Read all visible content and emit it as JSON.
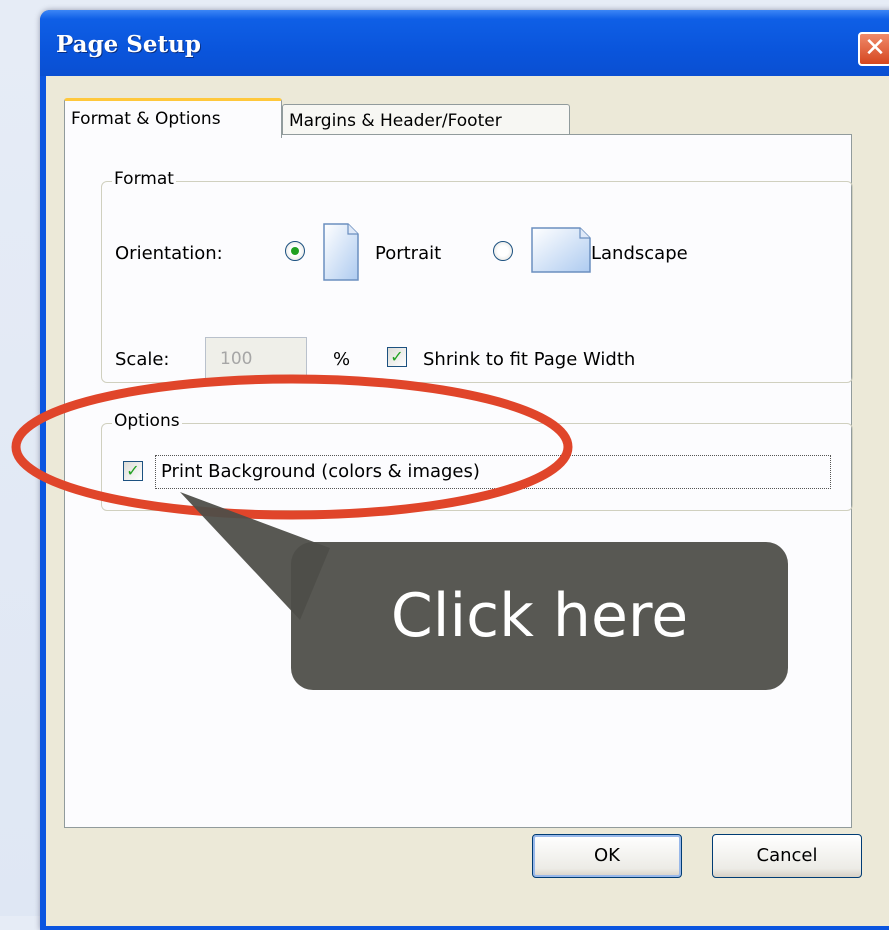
{
  "dialog": {
    "title": "Page Setup",
    "close_symbol": "✕"
  },
  "tabs": [
    {
      "label": "Format & Options",
      "active": true
    },
    {
      "label": "Margins & Header/Footer",
      "active": false
    }
  ],
  "format_group": {
    "label": "Format",
    "orientation_label": "Orientation:",
    "portrait_label": "Portrait",
    "landscape_label": "Landscape",
    "selected_orientation": "Portrait",
    "scale_label": "Scale:",
    "scale_value": "100",
    "percent_symbol": "%",
    "shrink_label": "Shrink to fit Page Width",
    "shrink_checked": true
  },
  "options_group": {
    "label": "Options",
    "print_background_label": "Print Background (colors & images)",
    "print_background_checked": true
  },
  "buttons": {
    "ok": "OK",
    "cancel": "Cancel"
  },
  "annotation": {
    "callout_text": "Click here",
    "highlight_color": "#e0452a",
    "callout_color": "#4e4e48"
  },
  "icons": {
    "portrait": "page-portrait-icon",
    "landscape": "page-landscape-icon",
    "check": "checkmark-icon"
  }
}
